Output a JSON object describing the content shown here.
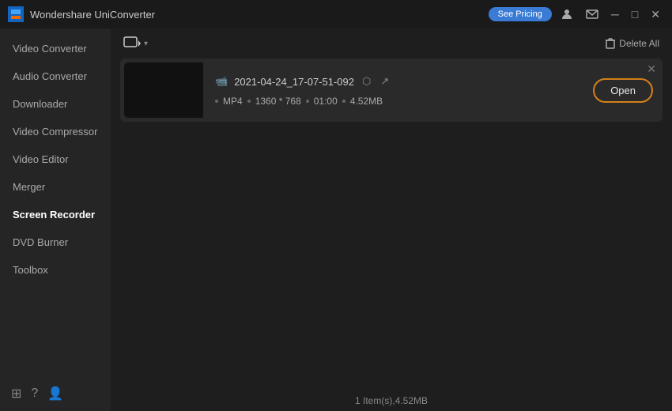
{
  "titleBar": {
    "appName": "Wondershare UniConverter",
    "seePricingLabel": "See Pricing",
    "windowControls": {
      "minimize": "─",
      "maximize": "□",
      "close": "✕"
    }
  },
  "sidebar": {
    "items": [
      {
        "id": "video-converter",
        "label": "Video Converter",
        "active": false
      },
      {
        "id": "audio-converter",
        "label": "Audio Converter",
        "active": false
      },
      {
        "id": "downloader",
        "label": "Downloader",
        "active": false
      },
      {
        "id": "video-compressor",
        "label": "Video Compressor",
        "active": false
      },
      {
        "id": "video-editor",
        "label": "Video Editor",
        "active": false
      },
      {
        "id": "merger",
        "label": "Merger",
        "active": false
      },
      {
        "id": "screen-recorder",
        "label": "Screen Recorder",
        "active": true
      },
      {
        "id": "dvd-burner",
        "label": "DVD Burner",
        "active": false
      },
      {
        "id": "toolbox",
        "label": "Toolbox",
        "active": false
      }
    ],
    "footer": {
      "layout": "⊞",
      "help": "?",
      "user": "👤"
    }
  },
  "toolbar": {
    "modeIcon": "📹",
    "deleteAllLabel": "Delete All"
  },
  "fileList": {
    "items": [
      {
        "id": "file-1",
        "name": "2021-04-24_17-07-51-092",
        "format": "MP4",
        "resolution": "1360 * 768",
        "duration": "01:00",
        "size": "4.52MB",
        "openLabel": "Open"
      }
    ]
  },
  "statusBar": {
    "text": "1 Item(s),4.52MB"
  }
}
